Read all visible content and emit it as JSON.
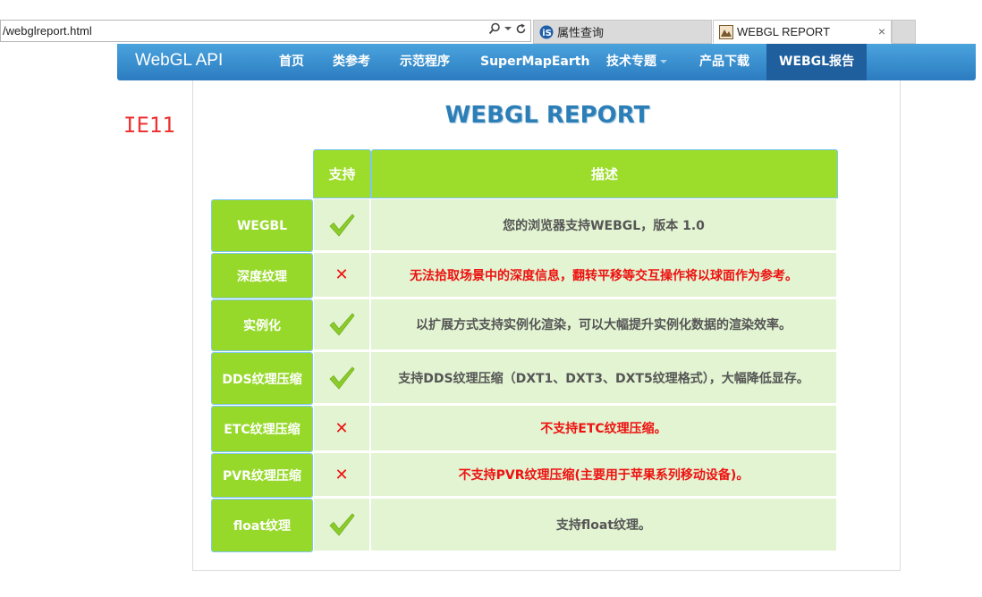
{
  "browser": {
    "url": "/webglreport.html",
    "tabs": [
      {
        "label": "属性查询",
        "icon": "is-logo-icon"
      },
      {
        "label": "WEBGL REPORT",
        "icon": "webgl-favicon-icon"
      }
    ],
    "close_label": "×"
  },
  "nav": {
    "brand": "WebGL API",
    "items": [
      {
        "label": "首页"
      },
      {
        "label": "类参考"
      },
      {
        "label": "示范程序"
      },
      {
        "label": "SuperMapEarth"
      },
      {
        "label": "技术专题"
      },
      {
        "label": "产品下载"
      },
      {
        "label": "WEBGL报告"
      }
    ],
    "active_index": 6,
    "accent": "#2b7cc0"
  },
  "browser_label": "IE11",
  "report": {
    "title": "WEBGL REPORT",
    "headers": {
      "support": "支持",
      "description": "描述"
    },
    "rows": [
      {
        "feature": "WEGBL",
        "supported": true,
        "description": "您的浏览器支持WEBGL，版本 1.0"
      },
      {
        "feature": "深度纹理",
        "supported": false,
        "description": "无法拾取场景中的深度信息，翻转平移等交互操作将以球面作为参考。"
      },
      {
        "feature": "实例化",
        "supported": true,
        "description": "以扩展方式支持实例化渲染，可以大幅提升实例化数据的渲染效率。"
      },
      {
        "feature": "DDS纹理压缩",
        "supported": true,
        "description": "支持DDS纹理压缩（DXT1、DXT3、DXT5纹理格式），大幅降低显存。"
      },
      {
        "feature": "ETC纹理压缩",
        "supported": false,
        "description": "不支持ETC纹理压缩。"
      },
      {
        "feature": "PVR纹理压缩",
        "supported": false,
        "description": "不支持PVR纹理压缩(主要用于苹果系列移动设备)。"
      },
      {
        "feature": "float纹理",
        "supported": true,
        "description": "支持float纹理。"
      }
    ],
    "colors": {
      "header": "#9cdc2a",
      "cell": "#e2f4d1",
      "fail": "#ee1111",
      "check": "#8ccc2a"
    },
    "icons": {
      "supported": "checkmark-icon",
      "unsupported": "cross-icon"
    },
    "cross_glyph": "✕"
  }
}
